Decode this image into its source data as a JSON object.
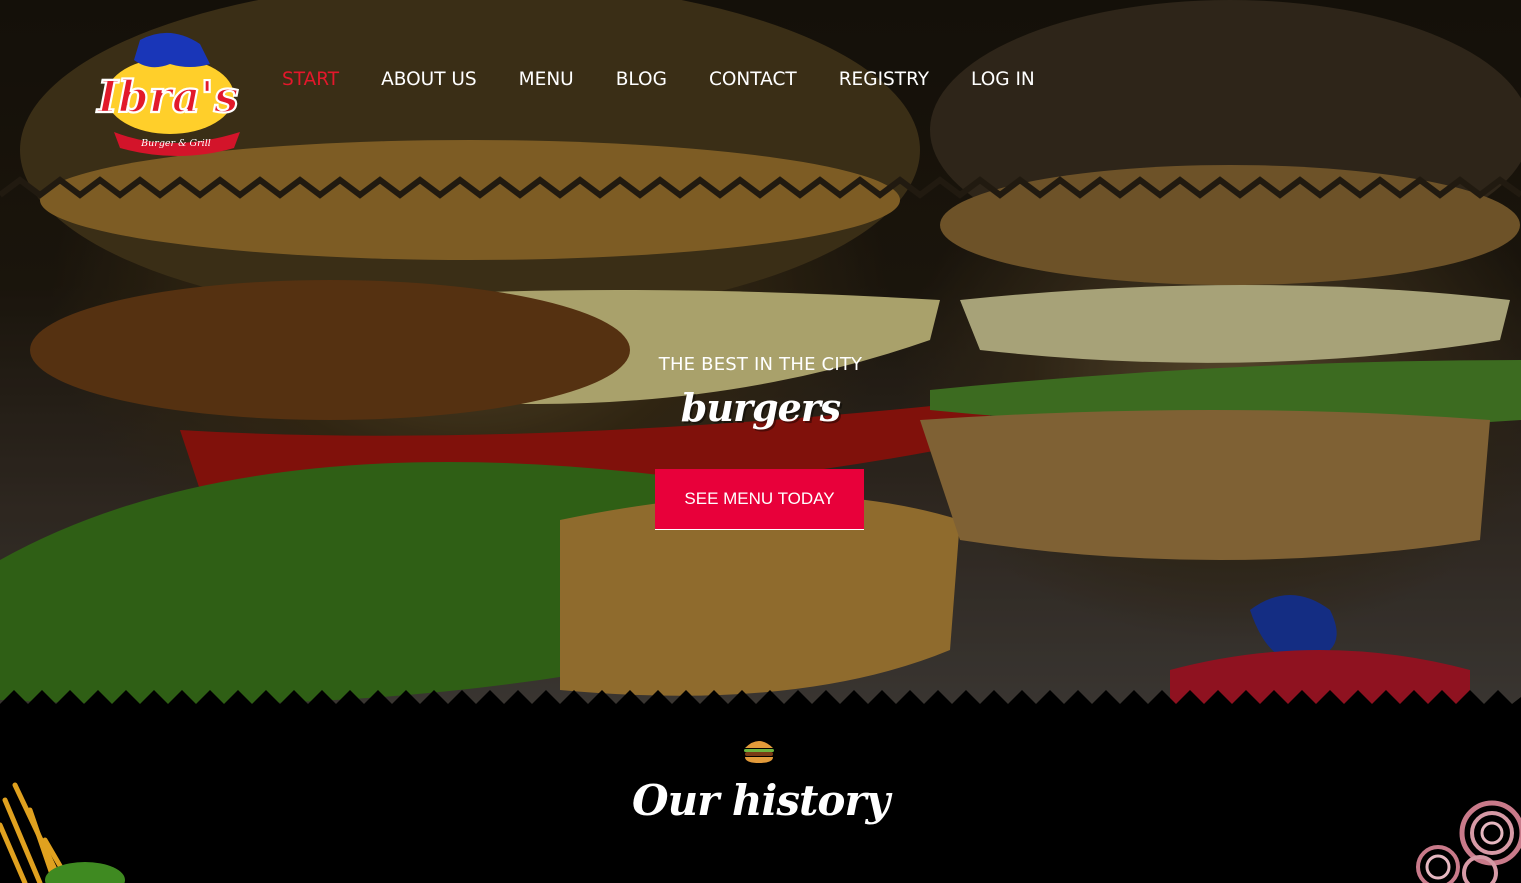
{
  "brand": {
    "logo_name": "Ibra's",
    "logo_sub": "Burger & Grill"
  },
  "nav": [
    {
      "label": "START",
      "active": true
    },
    {
      "label": "ABOUT US",
      "active": false
    },
    {
      "label": "MENU",
      "active": false
    },
    {
      "label": "BLOG",
      "active": false
    },
    {
      "label": "CONTACT",
      "active": false
    },
    {
      "label": "REGISTRY",
      "active": false
    },
    {
      "label": "LOG IN",
      "active": false
    }
  ],
  "hero": {
    "tagline": "THE BEST IN THE CITY",
    "title": "burgers",
    "cta_label": "SEE MENU TODAY"
  },
  "history": {
    "icon": "burger-icon",
    "title": "Our history"
  },
  "colors": {
    "accent": "#e8003a",
    "nav_active": "#e4172b",
    "background": "#000000"
  }
}
